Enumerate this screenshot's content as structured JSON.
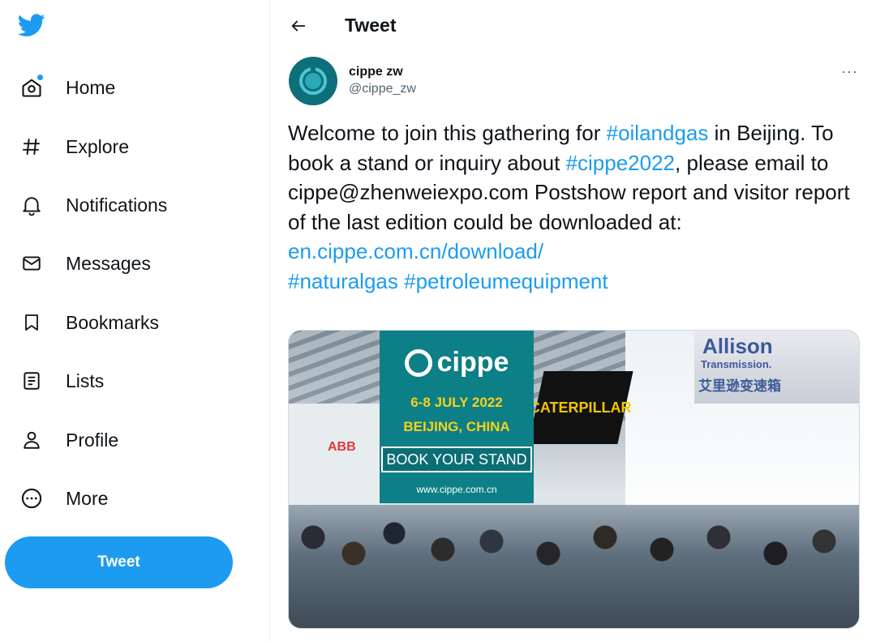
{
  "colors": {
    "accent": "#1d9bf0",
    "text": "#0f1419",
    "muted": "#536471"
  },
  "sidebar": {
    "logo_icon": "twitter-bird-icon",
    "items": [
      {
        "label": "Home",
        "icon": "home-icon"
      },
      {
        "label": "Explore",
        "icon": "hashtag-icon"
      },
      {
        "label": "Notifications",
        "icon": "bell-icon"
      },
      {
        "label": "Messages",
        "icon": "envelope-icon"
      },
      {
        "label": "Bookmarks",
        "icon": "bookmark-icon"
      },
      {
        "label": "Lists",
        "icon": "list-icon"
      },
      {
        "label": "Profile",
        "icon": "person-icon"
      },
      {
        "label": "More",
        "icon": "more-circle-icon"
      }
    ],
    "tweet_button": "Tweet"
  },
  "header": {
    "title": "Tweet",
    "back_icon": "back-arrow-icon"
  },
  "tweet": {
    "display_name": "cippe zw",
    "handle": "@cippe_zw",
    "more": "···",
    "text": {
      "p1": "Welcome to join this gathering for ",
      "h1": "#oilandgas",
      "p2": " in Beijing. To book a stand or inquiry about ",
      "h2": "#cippe2022",
      "p3": ", please email to cippe@zhenweiexpo.com Postshow report and visitor report of the last edition could be downloaded at: ",
      "link": "en.cippe.com.cn/download/",
      "h3": "#naturalgas",
      "h4": "#petroleumequipment"
    },
    "media": {
      "brand": "cippe",
      "date": "6-8 JULY 2022",
      "city": "BEIJING, CHINA",
      "cta": "BOOK YOUR STAND",
      "url": "www.cippe.com.cn",
      "abb": "ABB",
      "caterpillar": "CATERPILLAR",
      "allison": "Allison",
      "allison_sub": "Transmission.",
      "allison_cn": "艾里逊变速箱"
    }
  }
}
